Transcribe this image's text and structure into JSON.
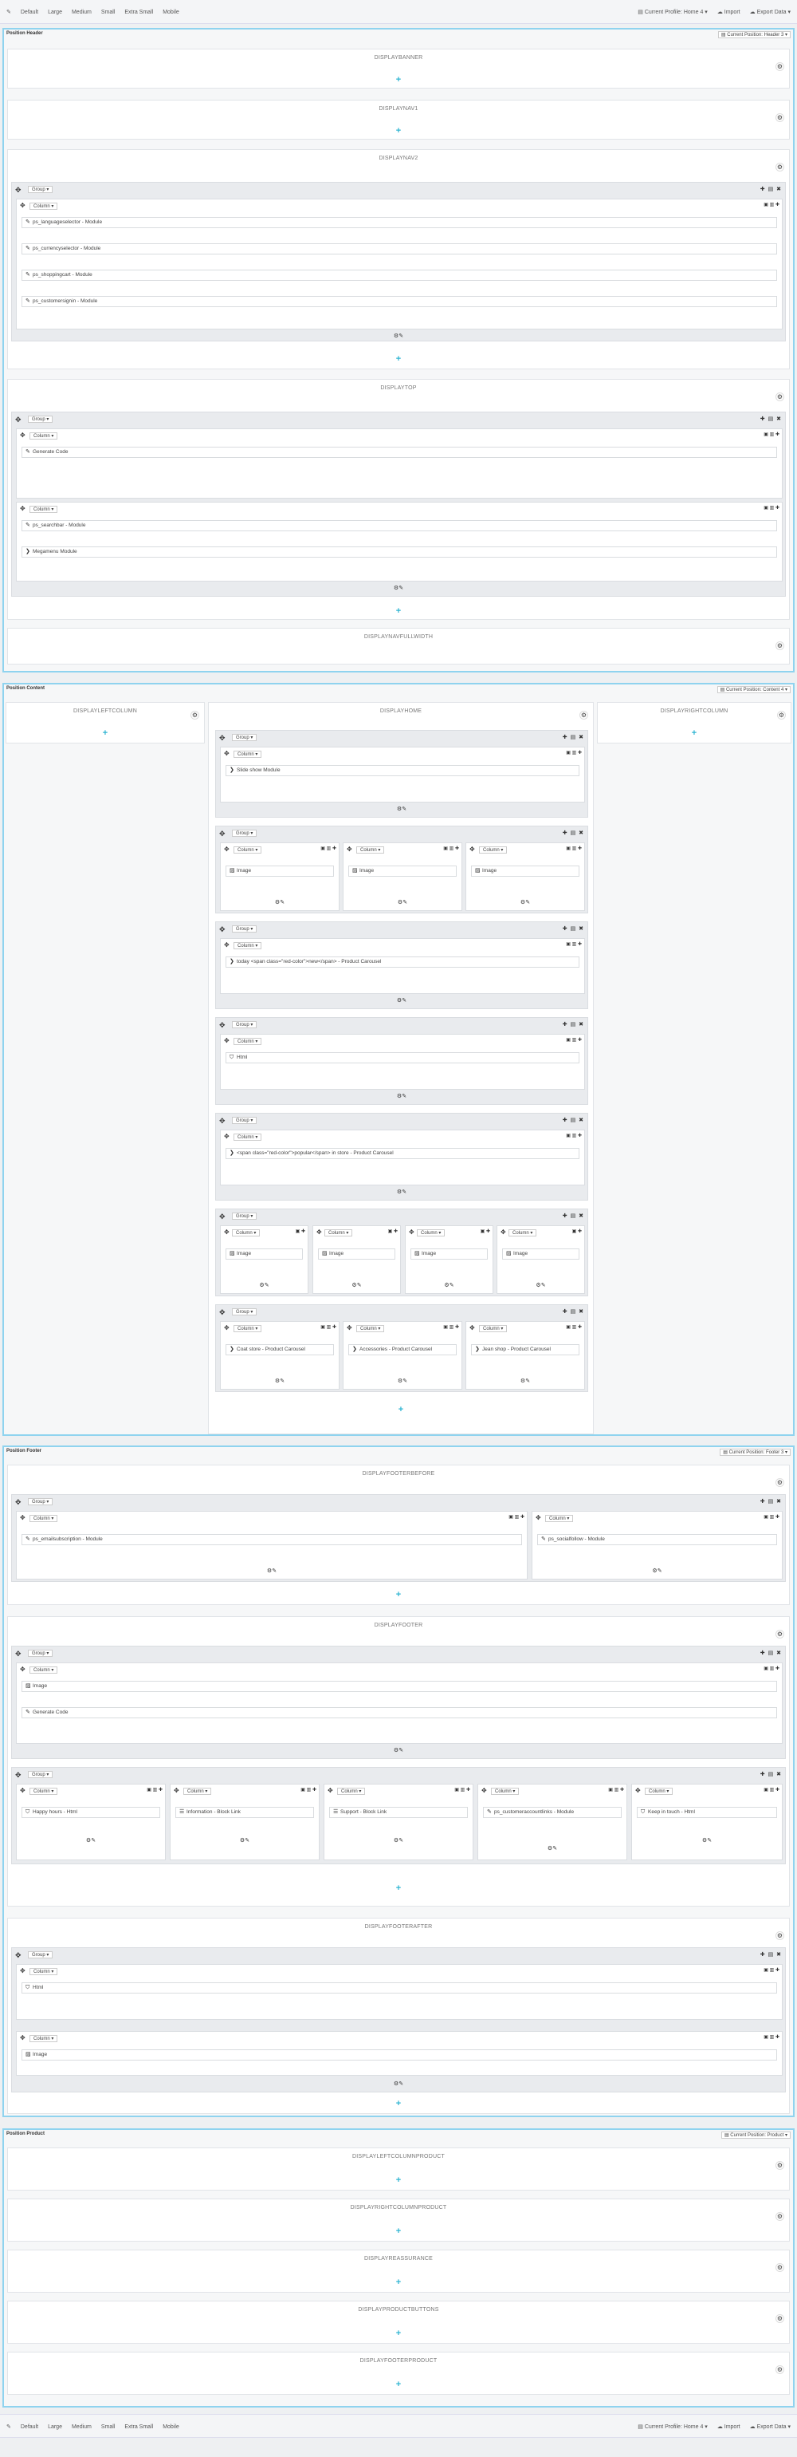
{
  "toolbar": {
    "icon": "pencil-icon",
    "devices": [
      "Default",
      "Large",
      "Medium",
      "Small",
      "Extra Small",
      "Mobile"
    ],
    "profile": "Current Profile: Home 4",
    "import": "Import",
    "export": "Export Data"
  },
  "positions": {
    "header": {
      "title": "Position Header",
      "menu": "Current Position: Header 3"
    },
    "content": {
      "title": "Position Content",
      "menu": "Current Position: Content 4"
    },
    "footer": {
      "title": "Position Footer",
      "menu": "Current Position: Footer 3"
    },
    "product": {
      "title": "Position Product",
      "menu": "Current Position: Product"
    }
  },
  "hooks": {
    "banner": "DISPLAYBANNER",
    "nav1": "DISPLAYNAV1",
    "nav2": "DISPLAYNAV2",
    "top": "DISPLAYTOP",
    "navfull": "DISPLAYNAVFULLWIDTH",
    "leftcol": "DISPLAYLEFTCOLUMN",
    "home": "DISPLAYHOME",
    "rightcol": "DISPLAYRIGHTCOLUMN",
    "footbefore": "DISPLAYFOOTERBEFORE",
    "footer": "DISPLAYFOOTER",
    "footafter": "DISPLAYFOOTERAFTER",
    "leftprod": "DISPLAYLEFTCOLUMNPRODUCT",
    "rightprod": "DISPLAYRIGHTCOLUMNPRODUCT",
    "reassurance": "DISPLAYREASSURANCE",
    "prodbuttons": "DISPLAYPRODUCTBUTTONS",
    "footprod": "DISPLAYFOOTERPRODUCT"
  },
  "labels": {
    "group": "Group",
    "column": "Column",
    "caret": "▾"
  },
  "widgets": {
    "lang": "ps_languageselector - Module",
    "curr": "ps_currencyselector - Module",
    "cart": "ps_shoppingcart - Module",
    "signin": "ps_customersignin - Module",
    "gencode1": "Generate Code",
    "search": "ps_searchbar - Module",
    "mega": "Megamenu Module",
    "slide": "Slide show Module",
    "img": "Image",
    "today": "today <span class=\"red-color\">new</span> - Product Carousel",
    "html": "Html",
    "popular": "<span class=\"red-color\">popular</span> in store - Product Carousel",
    "coat": "Coat store - Product Carousel",
    "acc": "Accessories - Product Carousel",
    "jean": "Jean shop - Product Carousel",
    "email": "ps_emailsubscription - Module",
    "social": "ps_socialfollow - Module",
    "gencode2": "Generate Code",
    "happy": "Happy hours - Html",
    "info": "Information - Block Link",
    "support": "Support - Block Link",
    "acclinks": "ps_customeraccountlinks - Module",
    "keep": "Keep in touch - Html"
  }
}
